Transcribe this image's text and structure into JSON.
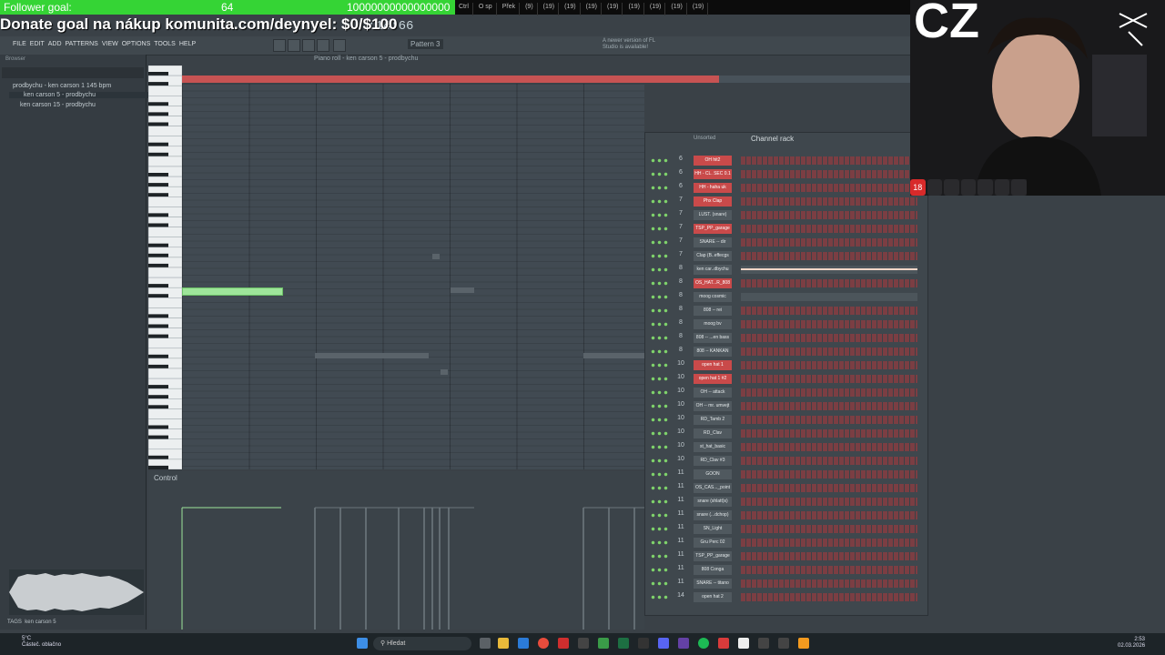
{
  "overlay": {
    "follower_goal_label": "Follower goal:",
    "follower_count": "64",
    "follower_target": "10000000000000000",
    "donate_text": "Donate goal na nákup komunita.com/deynyel: $0/$100"
  },
  "browser_tabs": [
    "Ctrl",
    "O sp",
    "Přek",
    "(9)",
    "(19)",
    "(19)",
    "(19)",
    "(19)",
    "(19)",
    "(19)",
    "(19)",
    "(19)"
  ],
  "fl": {
    "menu": [
      "FILE",
      "EDIT",
      "ADD",
      "PATTERNS",
      "VIEW",
      "OPTIONS",
      "TOOLS",
      "HELP"
    ],
    "clock": ":14:66",
    "pattern": "Pattern 3",
    "notice": "A newer version of FL Studio is available!",
    "browser": {
      "root": "Browser",
      "items": [
        "prodbychu - ken carson 1 145 bpm",
        "ken carson 5 - prodbychu",
        "ken carson 15 - prodbychu"
      ],
      "tag": "ken carson 5",
      "tag_label": "TAGS"
    },
    "piano_roll_title": "Piano roll - ken carson 5 - prodbychu",
    "control_label": "Control",
    "rack_title": "Channel rack",
    "rack_filter": "Unsorted",
    "channels": [
      {
        "num": "6",
        "name": "OH hit2",
        "red": true
      },
      {
        "num": "6",
        "name": "HH - CL. SEC 0.1",
        "red": true
      },
      {
        "num": "6",
        "name": "HH - haha uk",
        "red": true
      },
      {
        "num": "7",
        "name": "Phx Clap",
        "red": true
      },
      {
        "num": "7",
        "name": "LUST. (snare)",
        "red": false
      },
      {
        "num": "7",
        "name": "TSP_PP_garage",
        "red": true
      },
      {
        "num": "7",
        "name": "SNARE -- dir",
        "red": false
      },
      {
        "num": "7",
        "name": "Clap (B..effecgs",
        "red": false
      },
      {
        "num": "8",
        "name": "ken car..dbychu",
        "red": false
      },
      {
        "num": "8",
        "name": "OS_HAT...R_808",
        "red": true
      },
      {
        "num": "8",
        "name": "moog cosmic",
        "red": false
      },
      {
        "num": "8",
        "name": "808 -- rei",
        "red": false
      },
      {
        "num": "8",
        "name": "moog bv",
        "red": false
      },
      {
        "num": "8",
        "name": "808 -- ...en bass",
        "red": false
      },
      {
        "num": "8",
        "name": "808 -- KANKAN",
        "red": false
      },
      {
        "num": "10",
        "name": "open hat 1",
        "red": true
      },
      {
        "num": "10",
        "name": "open hat 1 #2",
        "red": true
      },
      {
        "num": "10",
        "name": "OH -- attack",
        "red": false
      },
      {
        "num": "10",
        "name": "OH -- mr. umvejt",
        "red": false
      },
      {
        "num": "10",
        "name": "RD_Tamb 2",
        "red": false
      },
      {
        "num": "10",
        "name": "RD_Clav",
        "red": false
      },
      {
        "num": "10",
        "name": "st_hat_basic",
        "red": false
      },
      {
        "num": "10",
        "name": "RD_Clav #3",
        "red": false
      },
      {
        "num": "11",
        "name": "GOON",
        "red": false
      },
      {
        "num": "11",
        "name": "OS_CAS..._point",
        "red": false
      },
      {
        "num": "11",
        "name": "snare (shlatt)s)",
        "red": false
      },
      {
        "num": "11",
        "name": "snare (...dchop)",
        "red": false
      },
      {
        "num": "11",
        "name": "SN_Light",
        "red": false
      },
      {
        "num": "11",
        "name": "Gru Perc 02",
        "red": false
      },
      {
        "num": "11",
        "name": "TSP_PP_garage",
        "red": false
      },
      {
        "num": "11",
        "name": "808 Conga",
        "red": false
      },
      {
        "num": "11",
        "name": "SNARE -- titano",
        "red": false
      },
      {
        "num": "14",
        "name": "open hat 2",
        "red": false
      }
    ]
  },
  "cam": {
    "label": "CZ",
    "badges": [
      "18",
      "",
      "",
      "",
      "",
      "",
      ""
    ]
  },
  "taskbar": {
    "weather_temp": "5°C",
    "weather_desc": "Částeč. oblačno",
    "search_placeholder": "Hledat",
    "time": "2:53",
    "date": "02.03.2026"
  },
  "colors": {
    "goal_green": "#35d435",
    "timeline_red": "#c75353",
    "channel_red": "#c94a4a"
  }
}
